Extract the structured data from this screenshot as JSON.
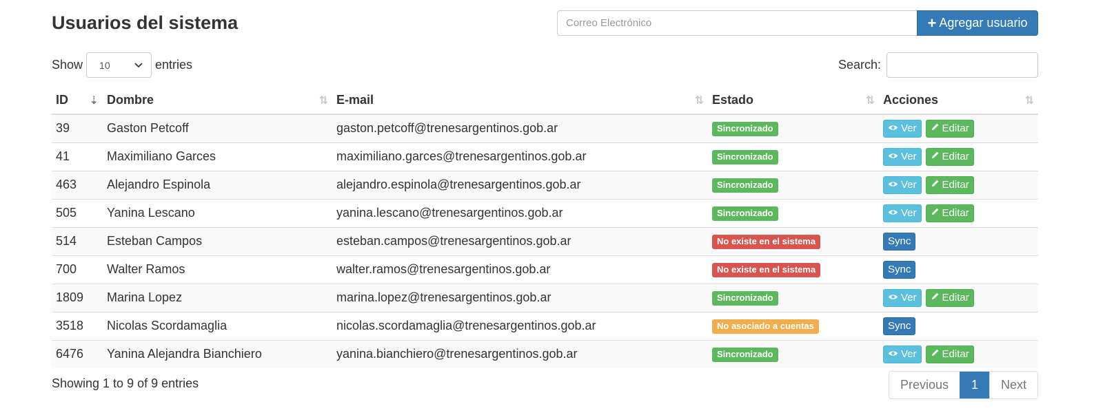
{
  "header": {
    "title": "Usuarios del sistema",
    "email_placeholder": "Correo Electrónico",
    "add_label": "Agregar usuario"
  },
  "controls": {
    "show_label": "Show",
    "length_value": "10",
    "entries_label": "entries",
    "search_label": "Search:",
    "search_value": ""
  },
  "table": {
    "columns": [
      "ID",
      "Dombre",
      "E-mail",
      "Estado",
      "Acciones"
    ],
    "rows": [
      {
        "id": "39",
        "name": "Gaston Petcoff",
        "email": "gaston.petcoff@trenesargentinos.gob.ar",
        "status": "Sincronizado",
        "status_type": "success",
        "actions": [
          "Ver",
          "Editar"
        ]
      },
      {
        "id": "41",
        "name": "Maximiliano Garces",
        "email": "maximiliano.garces@trenesargentinos.gob.ar",
        "status": "Sincronizado",
        "status_type": "success",
        "actions": [
          "Ver",
          "Editar"
        ]
      },
      {
        "id": "463",
        "name": "Alejandro Espinola",
        "email": "alejandro.espinola@trenesargentinos.gob.ar",
        "status": "Sincronizado",
        "status_type": "success",
        "actions": [
          "Ver",
          "Editar"
        ]
      },
      {
        "id": "505",
        "name": "Yanina Lescano",
        "email": "yanina.lescano@trenesargentinos.gob.ar",
        "status": "Sincronizado",
        "status_type": "success",
        "actions": [
          "Ver",
          "Editar"
        ]
      },
      {
        "id": "514",
        "name": "Esteban Campos",
        "email": "esteban.campos@trenesargentinos.gob.ar",
        "status": "No existe en el sistema",
        "status_type": "danger",
        "actions": [
          "Sync"
        ]
      },
      {
        "id": "700",
        "name": "Walter Ramos",
        "email": "walter.ramos@trenesargentinos.gob.ar",
        "status": "No existe en el sistema",
        "status_type": "danger",
        "actions": [
          "Sync"
        ]
      },
      {
        "id": "1809",
        "name": "Marina Lopez",
        "email": "marina.lopez@trenesargentinos.gob.ar",
        "status": "Sincronizado",
        "status_type": "success",
        "actions": [
          "Ver",
          "Editar"
        ]
      },
      {
        "id": "3518",
        "name": "Nicolas Scordamaglia",
        "email": "nicolas.scordamaglia@trenesargentinos.gob.ar",
        "status": "No asociado a cuentas",
        "status_type": "warning",
        "actions": [
          "Sync"
        ]
      },
      {
        "id": "6476",
        "name": "Yanina Alejandra Bianchiero",
        "email": "yanina.bianchiero@trenesargentinos.gob.ar",
        "status": "Sincronizado",
        "status_type": "success",
        "actions": [
          "Ver",
          "Editar"
        ]
      }
    ]
  },
  "footer": {
    "info": "Showing 1 to 9 of 9 entries",
    "previous": "Previous",
    "current_page": "1",
    "next": "Next"
  },
  "colors": {
    "primary": "#337ab7",
    "success": "#5cb85c",
    "info": "#5bc0de",
    "danger": "#d9534f",
    "warning": "#f0ad4e"
  },
  "icons": {
    "add": "plus-icon",
    "view": "eye-icon",
    "edit": "pencil-icon",
    "sort": "sort-icon",
    "select": "chevron-down-icon"
  }
}
